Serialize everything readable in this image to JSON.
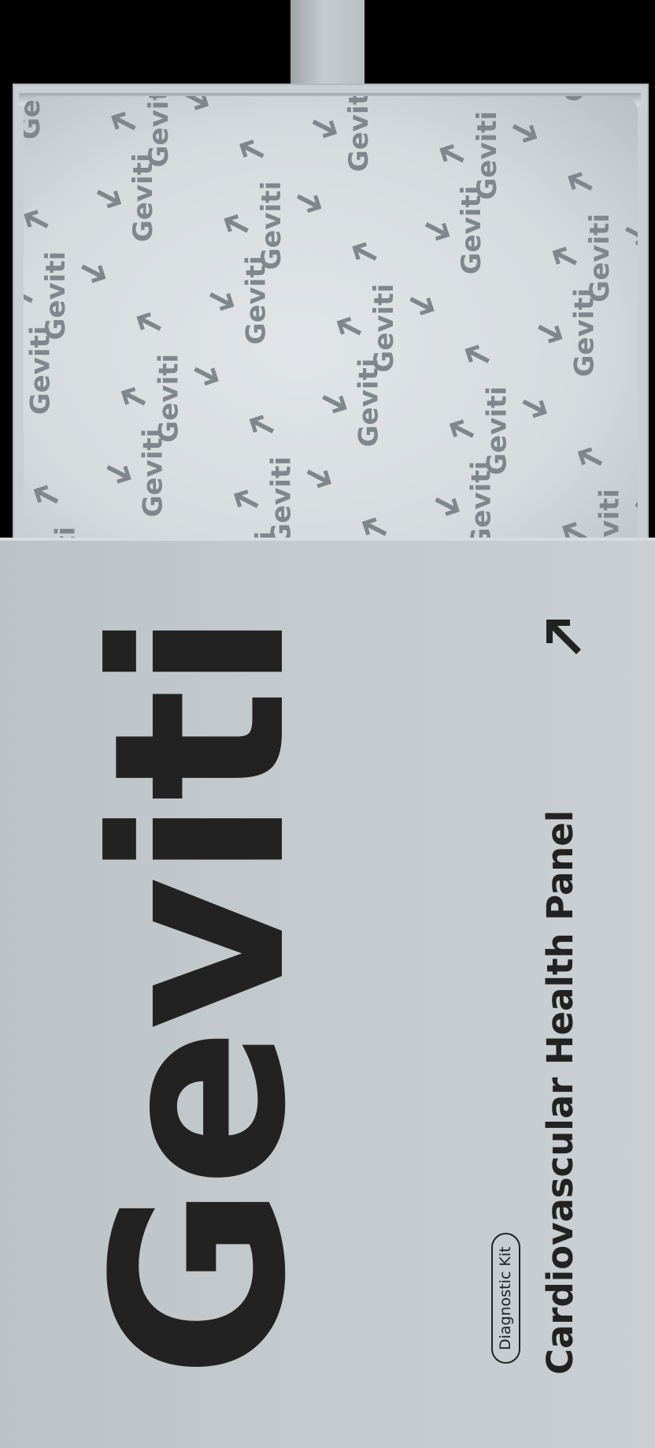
{
  "product": {
    "brand_logo": "Geviti",
    "title": "Cardiovascular Health Panel",
    "badge": "Diagnostic Kit",
    "pattern_text": "Geviti"
  },
  "icons": {
    "corner": "arrow-up-left-icon",
    "pattern": "arrow-icon"
  },
  "colors": {
    "background": "#000000",
    "packaging": "#c3c9cd",
    "wrap_paper": "#d9dee1",
    "pattern_ink": "#7f878c",
    "print_ink": "#222222"
  }
}
